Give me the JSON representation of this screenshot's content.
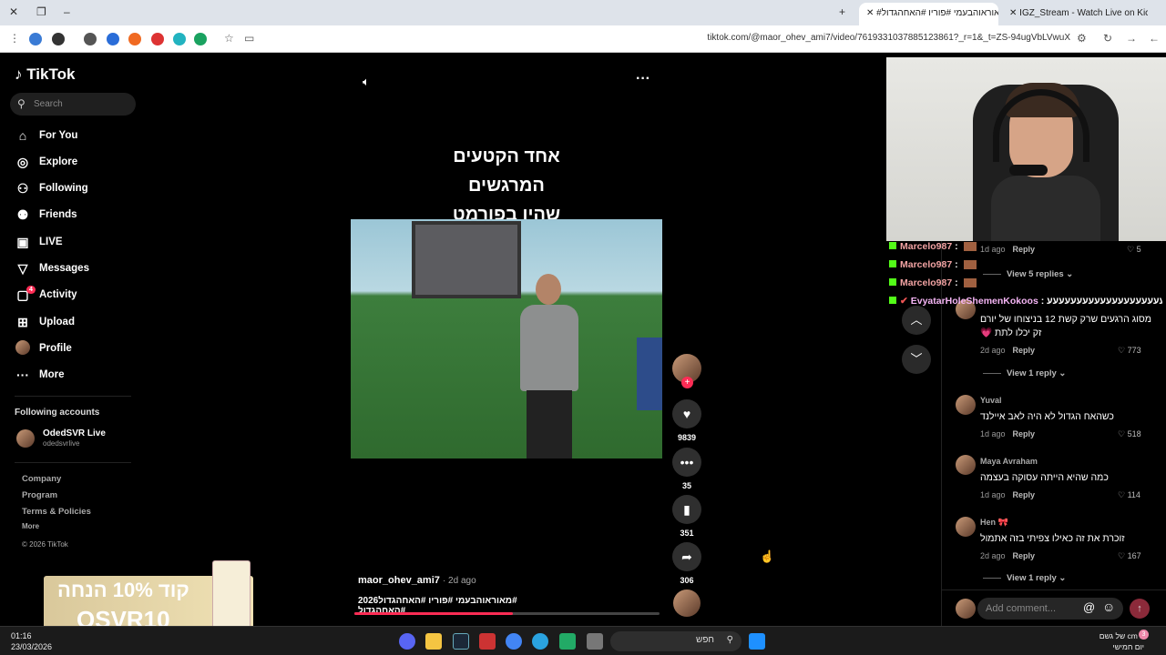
{
  "browser": {
    "tabs": [
      {
        "label": "IGZ_Stream - Watch Live on Kick"
      },
      {
        "label": "#מאוראוהבעמי #פוריו #האחהגדול"
      }
    ],
    "url": "tiktok.com/@maor_ohev_ami7/video/7619331037885123861?_r=1&_t=ZS-94ugVbLVwuX"
  },
  "sidebar": {
    "logo": "TikTok",
    "search_placeholder": "Search",
    "nav": [
      {
        "label": "For You",
        "icon": "home-icon"
      },
      {
        "label": "Explore",
        "icon": "compass-icon"
      },
      {
        "label": "Following",
        "icon": "following-icon"
      },
      {
        "label": "Friends",
        "icon": "friends-icon"
      },
      {
        "label": "LIVE",
        "icon": "live-icon"
      },
      {
        "label": "Messages",
        "icon": "messages-icon"
      },
      {
        "label": "Activity",
        "icon": "activity-icon",
        "badge": "4"
      },
      {
        "label": "Upload",
        "icon": "upload-icon"
      },
      {
        "label": "Profile",
        "icon": "profile-avatar"
      },
      {
        "label": "More",
        "icon": "more-icon"
      }
    ],
    "following_title": "Following accounts",
    "following": {
      "name": "OdedSVR Live",
      "handle": "odedsvrlive"
    },
    "footer": [
      "Company",
      "Program",
      "Terms & Policies",
      "More"
    ],
    "copyright": "© 2026 TikTok"
  },
  "video": {
    "caption_line1": "אחד הקטעים המרגשים",
    "caption_line2": "שהיו בפורמט",
    "author": "maor_ohev_ami7",
    "time": "· 2d ago",
    "tags": "#מאוראוהבעמי #פוריו #האחהגדול2026 #האחהגדול",
    "progress": 0.52,
    "likes": "9839",
    "comments": "35",
    "saves": "351",
    "shares": "306"
  },
  "chat": [
    {
      "user": "Marcelo987"
    },
    {
      "user": "Marcelo987"
    },
    {
      "user": "Marcelo987"
    },
    {
      "user": "EvyatarHoleShemenKokoos",
      "text": "עעעעעעעעעעעעעעעעעעעעע"
    }
  ],
  "comments": {
    "first": {
      "time": "1d ago",
      "reply": "Reply",
      "likes": "5",
      "view": "View 5 replies"
    },
    "items": [
      {
        "user": "",
        "text": "מסוג הרגעים שרק קשת 12 בניצוחו של יורם זק יכלו לתת 💗",
        "time": "2d ago",
        "reply": "Reply",
        "likes": "773",
        "view": "View 1 reply"
      },
      {
        "user": "Yuval",
        "text": "כשהאח הגדול לא היה לאב איילנד",
        "time": "1d ago",
        "reply": "Reply",
        "likes": "518"
      },
      {
        "user": "Maya Avraham",
        "text": "כמה שהיא הייתה עסוקה בעצמה",
        "time": "1d ago",
        "reply": "Reply",
        "likes": "114"
      },
      {
        "user": "Hen 🎀",
        "text": "זוכרת את זה כאילו צפיתי בזה אתמול",
        "time": "2d ago",
        "reply": "Reply",
        "likes": "167",
        "view": "View 1 reply"
      }
    ],
    "add_placeholder": "Add comment..."
  },
  "ad": {
    "line1": "קוד 10% הנחה",
    "line2": "OSVR10"
  },
  "taskbar": {
    "time": "01:16",
    "date": "23/03/2026",
    "search": "חפש",
    "weather1": "2 cm של גשם",
    "weather2": "יום חמישי",
    "notif": "3"
  },
  "colors": {
    "accent": "#fe2c55",
    "kick": "#53fc18"
  }
}
